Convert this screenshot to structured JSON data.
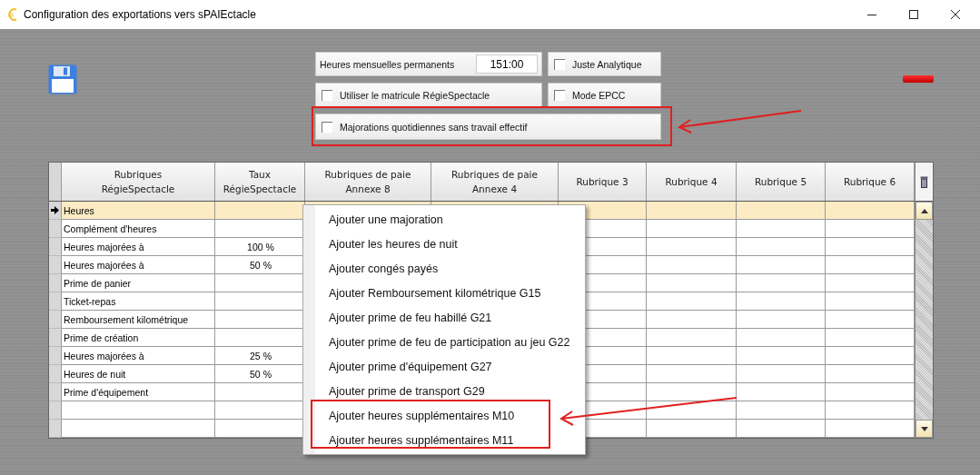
{
  "window": {
    "title": "Configuration des exportations vers sPAIEctacle"
  },
  "settings": {
    "hours_label": "Heures mensuelles permanents",
    "hours_value": "151:00",
    "checkboxes": [
      {
        "label": "Juste Analytique",
        "checked": false
      },
      {
        "label": "Utiliser le matricule RégieSpectacle",
        "checked": false
      },
      {
        "label": "Mode EPCC",
        "checked": false
      },
      {
        "label": "Majorations quotidiennes sans travail effectif",
        "checked": false
      }
    ]
  },
  "table": {
    "columns": [
      "Rubriques\nRégieSpectacle",
      "Taux\nRégieSpectacle",
      "Rubriques de paie\nAnnexe 8",
      "Rubriques de paie\nAnnexe 4",
      "Rubrique 3",
      "Rubrique 4",
      "Rubrique 5",
      "Rubrique 6"
    ],
    "rows": [
      {
        "rubrique": "Heures",
        "selected": true
      },
      {
        "rubrique": "Complément d'heures",
        "selected": false
      },
      {
        "rubrique": "Heures majorées à",
        "taux": "100 %",
        "selected": false
      },
      {
        "rubrique": "Heures majorées à",
        "taux": "50 %",
        "selected": false
      },
      {
        "rubrique": "Prime de panier",
        "selected": false
      },
      {
        "rubrique": "Ticket-repas",
        "selected": false
      },
      {
        "rubrique": "Remboursement kilométrique",
        "selected": false
      },
      {
        "rubrique": "Prime de création",
        "selected": false
      },
      {
        "rubrique": "Heures majorées à",
        "taux": "25 %",
        "selected": false
      },
      {
        "rubrique": "Heures de nuit",
        "taux": "50 %",
        "selected": false
      },
      {
        "rubrique": "Prime d'équipement",
        "selected": false
      },
      {
        "selected": false
      },
      {
        "selected": false
      }
    ]
  },
  "context_menu": {
    "items": [
      "Ajouter une majoration",
      "Ajouter les heures de nuit",
      "Ajouter congés payés",
      "Ajouter Remboursement kilométrique G15",
      "Ajouter prime de feu habillé G21",
      "Ajouter prime de feu de participation au jeu G22",
      "Ajouter prime d'équipement G27",
      "Ajouter prime de transport G29",
      "Ajouter heures supplémentaires M10",
      "Ajouter heures supplémentaires M11"
    ]
  }
}
